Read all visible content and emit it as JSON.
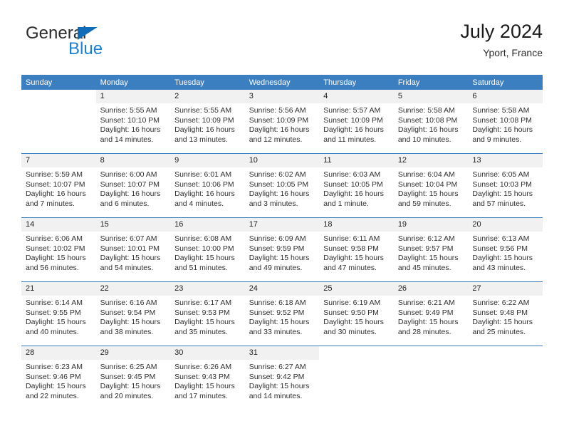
{
  "brand": {
    "name_part1": "General",
    "name_part2": "Blue",
    "triangle_color": "#0f6cb8",
    "blue_color": "#1b7fd4"
  },
  "header": {
    "title": "July 2024",
    "subtitle": "Yport, France"
  },
  "theme": {
    "header_blue": "#3c7fc1",
    "daynum_band": "#f1f1f1",
    "row_divider": "#3c7fc1"
  },
  "calendar": {
    "weekday_headers": [
      "Sunday",
      "Monday",
      "Tuesday",
      "Wednesday",
      "Thursday",
      "Friday",
      "Saturday"
    ],
    "weeks": [
      [
        {
          "day": "",
          "sunrise": "",
          "sunset": "",
          "daylight_line1": "",
          "daylight_line2": "",
          "blank": true
        },
        {
          "day": "1",
          "sunrise": "Sunrise: 5:55 AM",
          "sunset": "Sunset: 10:10 PM",
          "daylight_line1": "Daylight: 16 hours",
          "daylight_line2": "and 14 minutes."
        },
        {
          "day": "2",
          "sunrise": "Sunrise: 5:55 AM",
          "sunset": "Sunset: 10:09 PM",
          "daylight_line1": "Daylight: 16 hours",
          "daylight_line2": "and 13 minutes."
        },
        {
          "day": "3",
          "sunrise": "Sunrise: 5:56 AM",
          "sunset": "Sunset: 10:09 PM",
          "daylight_line1": "Daylight: 16 hours",
          "daylight_line2": "and 12 minutes."
        },
        {
          "day": "4",
          "sunrise": "Sunrise: 5:57 AM",
          "sunset": "Sunset: 10:09 PM",
          "daylight_line1": "Daylight: 16 hours",
          "daylight_line2": "and 11 minutes."
        },
        {
          "day": "5",
          "sunrise": "Sunrise: 5:58 AM",
          "sunset": "Sunset: 10:08 PM",
          "daylight_line1": "Daylight: 16 hours",
          "daylight_line2": "and 10 minutes."
        },
        {
          "day": "6",
          "sunrise": "Sunrise: 5:58 AM",
          "sunset": "Sunset: 10:08 PM",
          "daylight_line1": "Daylight: 16 hours",
          "daylight_line2": "and 9 minutes."
        }
      ],
      [
        {
          "day": "7",
          "sunrise": "Sunrise: 5:59 AM",
          "sunset": "Sunset: 10:07 PM",
          "daylight_line1": "Daylight: 16 hours",
          "daylight_line2": "and 7 minutes."
        },
        {
          "day": "8",
          "sunrise": "Sunrise: 6:00 AM",
          "sunset": "Sunset: 10:07 PM",
          "daylight_line1": "Daylight: 16 hours",
          "daylight_line2": "and 6 minutes."
        },
        {
          "day": "9",
          "sunrise": "Sunrise: 6:01 AM",
          "sunset": "Sunset: 10:06 PM",
          "daylight_line1": "Daylight: 16 hours",
          "daylight_line2": "and 4 minutes."
        },
        {
          "day": "10",
          "sunrise": "Sunrise: 6:02 AM",
          "sunset": "Sunset: 10:05 PM",
          "daylight_line1": "Daylight: 16 hours",
          "daylight_line2": "and 3 minutes."
        },
        {
          "day": "11",
          "sunrise": "Sunrise: 6:03 AM",
          "sunset": "Sunset: 10:05 PM",
          "daylight_line1": "Daylight: 16 hours",
          "daylight_line2": "and 1 minute."
        },
        {
          "day": "12",
          "sunrise": "Sunrise: 6:04 AM",
          "sunset": "Sunset: 10:04 PM",
          "daylight_line1": "Daylight: 15 hours",
          "daylight_line2": "and 59 minutes."
        },
        {
          "day": "13",
          "sunrise": "Sunrise: 6:05 AM",
          "sunset": "Sunset: 10:03 PM",
          "daylight_line1": "Daylight: 15 hours",
          "daylight_line2": "and 57 minutes."
        }
      ],
      [
        {
          "day": "14",
          "sunrise": "Sunrise: 6:06 AM",
          "sunset": "Sunset: 10:02 PM",
          "daylight_line1": "Daylight: 15 hours",
          "daylight_line2": "and 56 minutes."
        },
        {
          "day": "15",
          "sunrise": "Sunrise: 6:07 AM",
          "sunset": "Sunset: 10:01 PM",
          "daylight_line1": "Daylight: 15 hours",
          "daylight_line2": "and 54 minutes."
        },
        {
          "day": "16",
          "sunrise": "Sunrise: 6:08 AM",
          "sunset": "Sunset: 10:00 PM",
          "daylight_line1": "Daylight: 15 hours",
          "daylight_line2": "and 51 minutes."
        },
        {
          "day": "17",
          "sunrise": "Sunrise: 6:09 AM",
          "sunset": "Sunset: 9:59 PM",
          "daylight_line1": "Daylight: 15 hours",
          "daylight_line2": "and 49 minutes."
        },
        {
          "day": "18",
          "sunrise": "Sunrise: 6:11 AM",
          "sunset": "Sunset: 9:58 PM",
          "daylight_line1": "Daylight: 15 hours",
          "daylight_line2": "and 47 minutes."
        },
        {
          "day": "19",
          "sunrise": "Sunrise: 6:12 AM",
          "sunset": "Sunset: 9:57 PM",
          "daylight_line1": "Daylight: 15 hours",
          "daylight_line2": "and 45 minutes."
        },
        {
          "day": "20",
          "sunrise": "Sunrise: 6:13 AM",
          "sunset": "Sunset: 9:56 PM",
          "daylight_line1": "Daylight: 15 hours",
          "daylight_line2": "and 43 minutes."
        }
      ],
      [
        {
          "day": "21",
          "sunrise": "Sunrise: 6:14 AM",
          "sunset": "Sunset: 9:55 PM",
          "daylight_line1": "Daylight: 15 hours",
          "daylight_line2": "and 40 minutes."
        },
        {
          "day": "22",
          "sunrise": "Sunrise: 6:16 AM",
          "sunset": "Sunset: 9:54 PM",
          "daylight_line1": "Daylight: 15 hours",
          "daylight_line2": "and 38 minutes."
        },
        {
          "day": "23",
          "sunrise": "Sunrise: 6:17 AM",
          "sunset": "Sunset: 9:53 PM",
          "daylight_line1": "Daylight: 15 hours",
          "daylight_line2": "and 35 minutes."
        },
        {
          "day": "24",
          "sunrise": "Sunrise: 6:18 AM",
          "sunset": "Sunset: 9:52 PM",
          "daylight_line1": "Daylight: 15 hours",
          "daylight_line2": "and 33 minutes."
        },
        {
          "day": "25",
          "sunrise": "Sunrise: 6:19 AM",
          "sunset": "Sunset: 9:50 PM",
          "daylight_line1": "Daylight: 15 hours",
          "daylight_line2": "and 30 minutes."
        },
        {
          "day": "26",
          "sunrise": "Sunrise: 6:21 AM",
          "sunset": "Sunset: 9:49 PM",
          "daylight_line1": "Daylight: 15 hours",
          "daylight_line2": "and 28 minutes."
        },
        {
          "day": "27",
          "sunrise": "Sunrise: 6:22 AM",
          "sunset": "Sunset: 9:48 PM",
          "daylight_line1": "Daylight: 15 hours",
          "daylight_line2": "and 25 minutes."
        }
      ],
      [
        {
          "day": "28",
          "sunrise": "Sunrise: 6:23 AM",
          "sunset": "Sunset: 9:46 PM",
          "daylight_line1": "Daylight: 15 hours",
          "daylight_line2": "and 22 minutes."
        },
        {
          "day": "29",
          "sunrise": "Sunrise: 6:25 AM",
          "sunset": "Sunset: 9:45 PM",
          "daylight_line1": "Daylight: 15 hours",
          "daylight_line2": "and 20 minutes."
        },
        {
          "day": "30",
          "sunrise": "Sunrise: 6:26 AM",
          "sunset": "Sunset: 9:43 PM",
          "daylight_line1": "Daylight: 15 hours",
          "daylight_line2": "and 17 minutes."
        },
        {
          "day": "31",
          "sunrise": "Sunrise: 6:27 AM",
          "sunset": "Sunset: 9:42 PM",
          "daylight_line1": "Daylight: 15 hours",
          "daylight_line2": "and 14 minutes."
        },
        {
          "day": "",
          "sunrise": "",
          "sunset": "",
          "daylight_line1": "",
          "daylight_line2": "",
          "blank": true
        },
        {
          "day": "",
          "sunrise": "",
          "sunset": "",
          "daylight_line1": "",
          "daylight_line2": "",
          "blank": true
        },
        {
          "day": "",
          "sunrise": "",
          "sunset": "",
          "daylight_line1": "",
          "daylight_line2": "",
          "blank": true
        }
      ]
    ]
  }
}
